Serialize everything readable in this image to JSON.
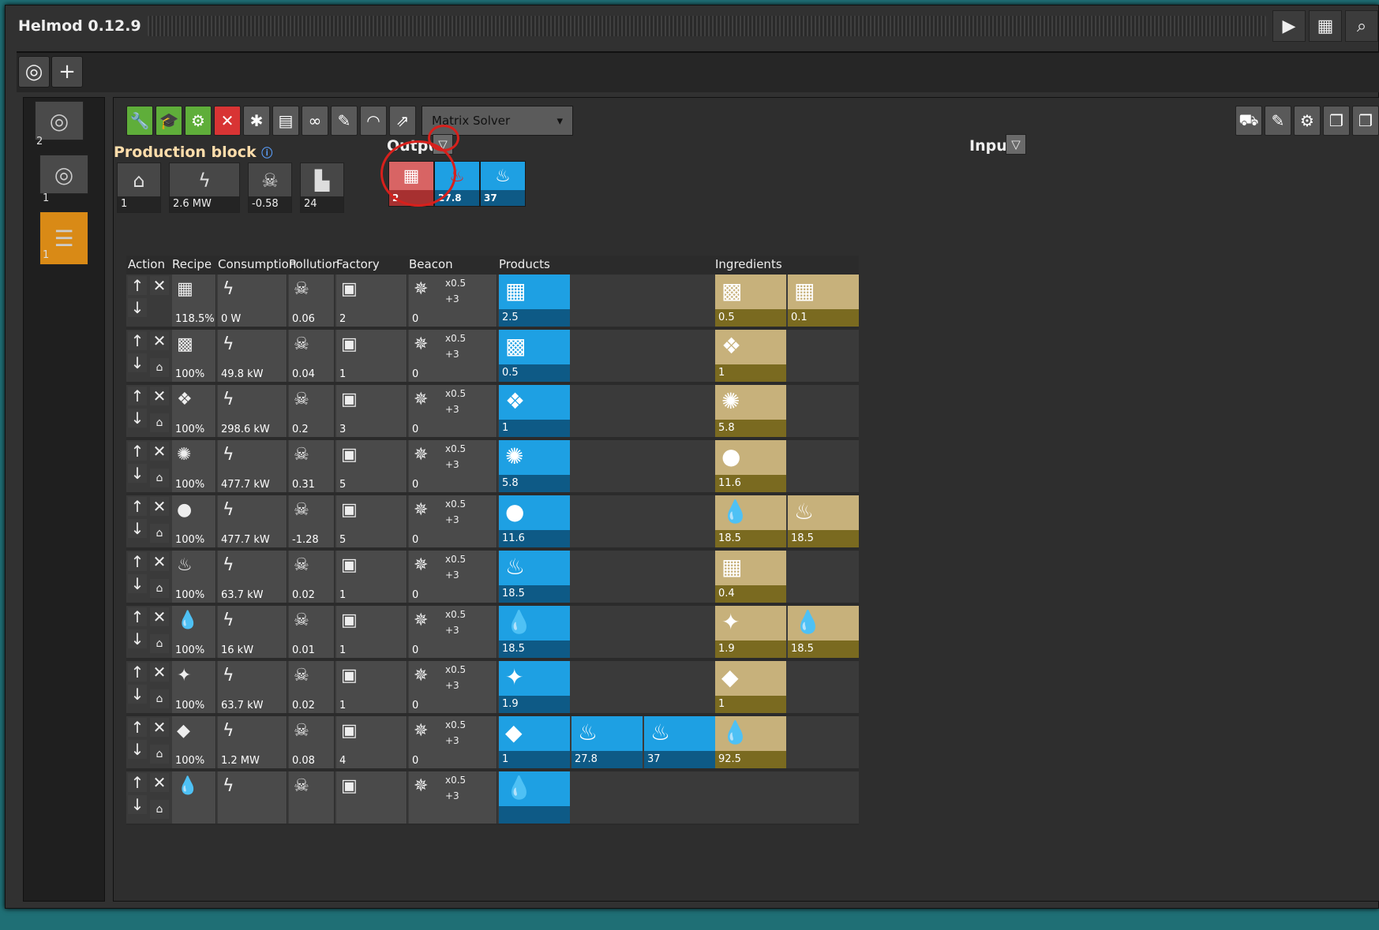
{
  "app": {
    "title": "Helmod 0.12.9"
  },
  "titlebar": {
    "play_icon": "play-icon",
    "calc_icon": "calculator-icon",
    "search_icon": "search-icon"
  },
  "sidebar": {
    "items": [
      {
        "label": "2"
      },
      {
        "label": "1"
      },
      {
        "label": "1"
      }
    ]
  },
  "toolbar": {
    "solver": "Matrix Solver"
  },
  "block": {
    "heading": "Production block",
    "stats": [
      {
        "icon": "building-icon",
        "value": "1"
      },
      {
        "icon": "lightning-icon",
        "value": "2.6 MW"
      },
      {
        "icon": "skull-icon",
        "value": "-0.58"
      },
      {
        "icon": "factory-icon",
        "value": "24"
      }
    ],
    "output_label": "Output",
    "input_label": "Input",
    "outputs": [
      {
        "icon": "coal-icon",
        "value": "2",
        "color": "red"
      },
      {
        "icon": "gas-icon",
        "value": "27.8",
        "color": "blue"
      },
      {
        "icon": "steam-icon",
        "value": "37",
        "color": "blue"
      }
    ]
  },
  "table": {
    "headers": [
      "Action",
      "Recipe",
      "Consumption",
      "Pollution",
      "Factory",
      "Beacon",
      "Products",
      "Ingredients"
    ],
    "beacon_multiplier": "x0.5",
    "beacon_modules": "+3",
    "rows": [
      {
        "recipe": "118.5%",
        "consumption": "0 W",
        "pollution": "0.06",
        "factory": "2",
        "beacon": "0",
        "products": [
          "2.5"
        ],
        "ingredients": [
          "0.5",
          "0.1"
        ]
      },
      {
        "recipe": "100%",
        "consumption": "49.8 kW",
        "pollution": "0.04",
        "factory": "1",
        "beacon": "0",
        "products": [
          "0.5"
        ],
        "ingredients": [
          "1"
        ]
      },
      {
        "recipe": "100%",
        "consumption": "298.6 kW",
        "pollution": "0.2",
        "factory": "3",
        "beacon": "0",
        "products": [
          "1"
        ],
        "ingredients": [
          "5.8"
        ]
      },
      {
        "recipe": "100%",
        "consumption": "477.7 kW",
        "pollution": "0.31",
        "factory": "5",
        "beacon": "0",
        "products": [
          "5.8"
        ],
        "ingredients": [
          "11.6"
        ]
      },
      {
        "recipe": "100%",
        "consumption": "477.7 kW",
        "pollution": "-1.28",
        "factory": "5",
        "beacon": "0",
        "products": [
          "11.6"
        ],
        "ingredients": [
          "18.5",
          "18.5"
        ]
      },
      {
        "recipe": "100%",
        "consumption": "63.7 kW",
        "pollution": "0.02",
        "factory": "1",
        "beacon": "0",
        "products": [
          "18.5"
        ],
        "ingredients": [
          "0.4"
        ]
      },
      {
        "recipe": "100%",
        "consumption": "16 kW",
        "pollution": "0.01",
        "factory": "1",
        "beacon": "0",
        "products": [
          "18.5"
        ],
        "ingredients": [
          "1.9",
          "18.5"
        ]
      },
      {
        "recipe": "100%",
        "consumption": "63.7 kW",
        "pollution": "0.02",
        "factory": "1",
        "beacon": "0",
        "products": [
          "1.9"
        ],
        "ingredients": [
          "1"
        ]
      },
      {
        "recipe": "100%",
        "consumption": "1.2 MW",
        "pollution": "0.08",
        "factory": "4",
        "beacon": "0",
        "products": [
          "1",
          "27.8",
          "37"
        ],
        "ingredients": [
          "92.5"
        ]
      },
      {
        "recipe": "",
        "consumption": "",
        "pollution": "",
        "factory": "",
        "beacon": "",
        "products": [
          ""
        ],
        "ingredients": []
      }
    ]
  }
}
